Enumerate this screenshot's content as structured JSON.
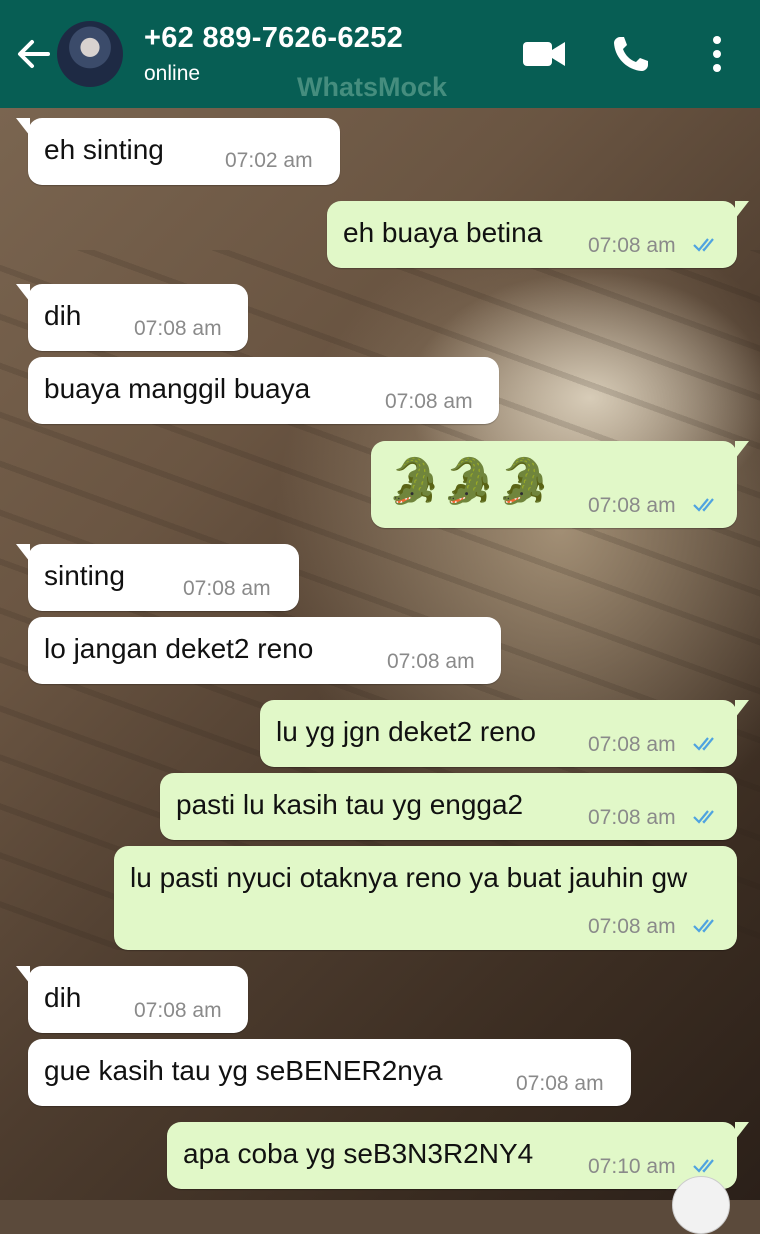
{
  "header": {
    "contact_name": "+62 889-7626-6252",
    "status": "online",
    "watermark": "WhatsMock",
    "color": "#075e54"
  },
  "icons": {
    "back": "arrow-left-icon",
    "video": "video-call-icon",
    "call": "phone-icon",
    "menu": "more-vertical-icon"
  },
  "colors": {
    "incoming_bubble": "#ffffff",
    "outgoing_bubble": "#e1f8c8",
    "read_ticks": "#4fa3e0"
  },
  "messages": [
    {
      "dir": "in",
      "text": "eh sinting",
      "time": "07:02 am"
    },
    {
      "dir": "out",
      "text": "eh buaya betina",
      "time": "07:08 am",
      "read": true
    },
    {
      "dir": "in",
      "text": "dih",
      "time": "07:08 am"
    },
    {
      "dir": "in",
      "text": "buaya manggil buaya",
      "time": "07:08 am"
    },
    {
      "dir": "out",
      "text": "🐊🐊🐊",
      "time": "07:08 am",
      "read": true
    },
    {
      "dir": "in",
      "text": "sinting",
      "time": "07:08 am"
    },
    {
      "dir": "in",
      "text": "lo jangan deket2 reno",
      "time": "07:08 am"
    },
    {
      "dir": "out",
      "text": "lu yg jgn deket2 reno",
      "time": "07:08 am",
      "read": true
    },
    {
      "dir": "out",
      "text": "pasti lu kasih tau yg engga2",
      "time": "07:08 am",
      "read": true
    },
    {
      "dir": "out",
      "text": "lu pasti nyuci otaknya reno ya buat jauhin gw",
      "time": "07:08 am",
      "read": true
    },
    {
      "dir": "in",
      "text": "dih",
      "time": "07:08 am"
    },
    {
      "dir": "in",
      "text": "gue kasih tau yg seBENER2nya",
      "time": "07:08 am"
    },
    {
      "dir": "out",
      "text": "apa coba yg seB3N3R2NY4",
      "time": "07:10 am",
      "read": true
    }
  ]
}
